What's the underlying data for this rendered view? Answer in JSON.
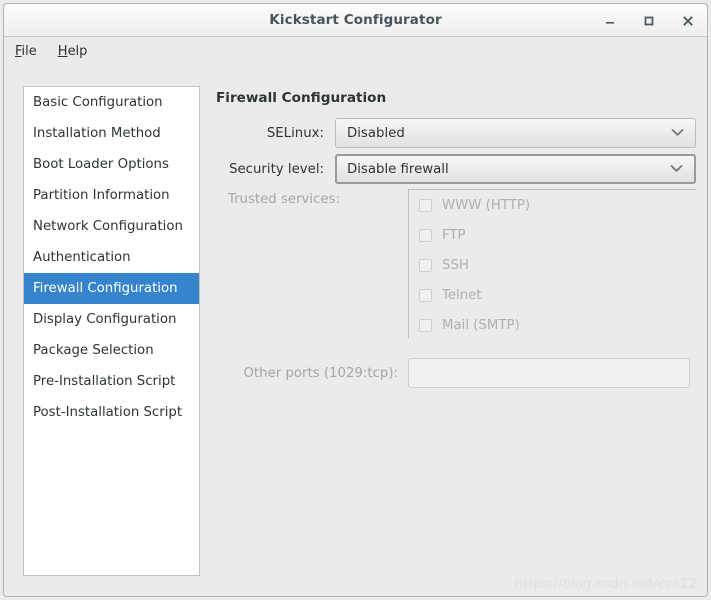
{
  "window": {
    "title": "Kickstart Configurator",
    "controls": [
      {
        "name": "minimize",
        "label": "–"
      },
      {
        "name": "maximize",
        "label": "□"
      },
      {
        "name": "close",
        "label": "✕"
      }
    ]
  },
  "menubar": {
    "items": [
      {
        "mnemonic": "F",
        "rest": "ile"
      },
      {
        "mnemonic": "H",
        "rest": "elp"
      }
    ]
  },
  "sidebar": {
    "selected_index": 6,
    "items": [
      {
        "label": "Basic Configuration"
      },
      {
        "label": "Installation Method"
      },
      {
        "label": "Boot Loader Options"
      },
      {
        "label": "Partition Information"
      },
      {
        "label": "Network Configuration"
      },
      {
        "label": "Authentication"
      },
      {
        "label": "Firewall Configuration"
      },
      {
        "label": "Display Configuration"
      },
      {
        "label": "Package Selection"
      },
      {
        "label": "Pre-Installation Script"
      },
      {
        "label": "Post-Installation Script"
      }
    ]
  },
  "panel": {
    "title": "Firewall Configuration",
    "selinux": {
      "label": "SELinux:",
      "value": "Disabled",
      "focused": false
    },
    "security_level": {
      "label": "Security level:",
      "value": "Disable firewall",
      "focused": true
    },
    "trusted_services": {
      "label": "Trusted services:",
      "disabled": true,
      "items": [
        {
          "label": "WWW (HTTP)",
          "checked": false
        },
        {
          "label": "FTP",
          "checked": false
        },
        {
          "label": "SSH",
          "checked": false
        },
        {
          "label": "Telnet",
          "checked": false
        },
        {
          "label": "Mail (SMTP)",
          "checked": false
        }
      ]
    },
    "other_ports": {
      "label": "Other ports (1029:tcp):",
      "value": "",
      "placeholder": "",
      "disabled": true
    }
  },
  "watermark": {
    "text": "https://blog.csdn.net/ccc22"
  },
  "colors": {
    "selection_blue": "#3584cd",
    "window_bg": "#ebebeb",
    "list_bg": "#ffffff",
    "text": "#2e3436",
    "disabled_text": "#a6a6a6",
    "title_text": "#48545c"
  }
}
